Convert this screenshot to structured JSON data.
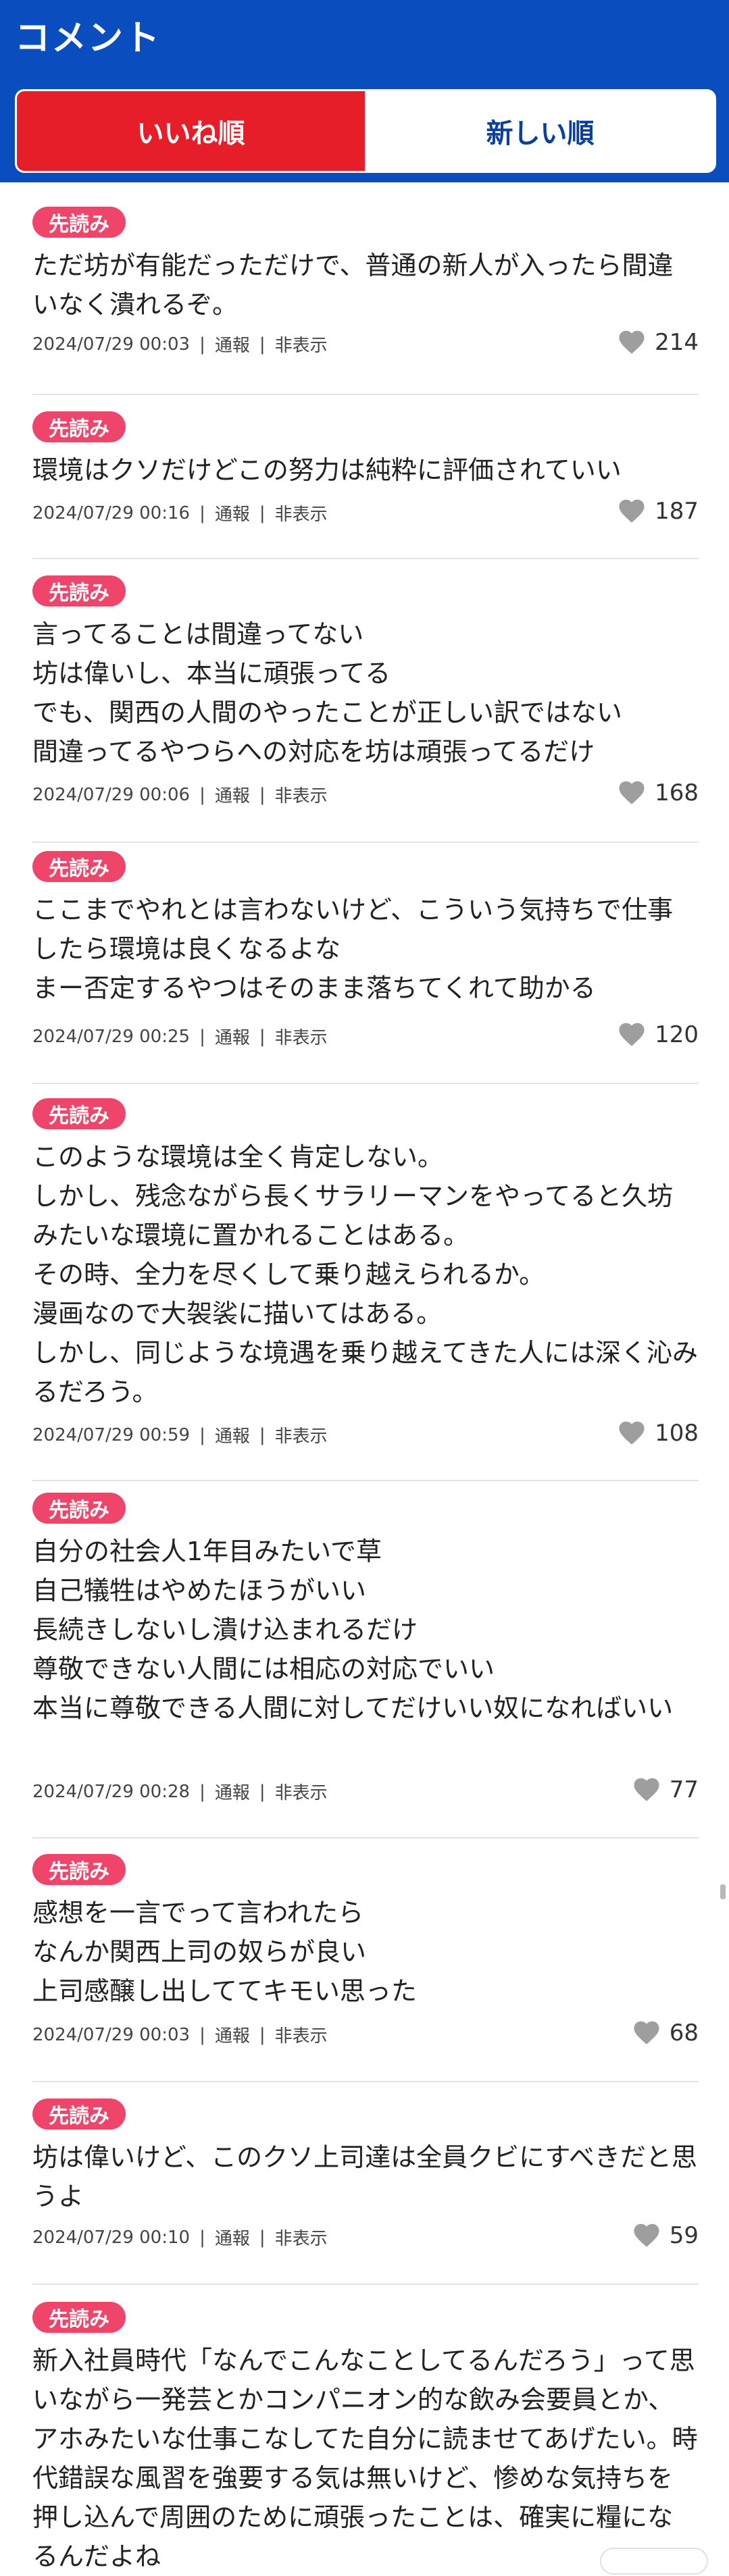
{
  "header": {
    "title": "コメント"
  },
  "tabs": [
    {
      "label": "いいね順",
      "active": true
    },
    {
      "label": "新しい順",
      "active": false
    }
  ],
  "colors": {
    "header_bg": "#0a4dbf",
    "active_tab": "#e61e2a",
    "badge": "#f0456a",
    "heart": "#9e9e9e"
  },
  "meta_labels": {
    "report": "通報",
    "hide": "非表示",
    "separator": "|"
  },
  "comments": [
    {
      "badge": "先読み",
      "text": "ただ坊が有能だっただけで、普通の新人が入ったら間違いなく潰れるぞ。",
      "date": "2024/07/29 00:03",
      "likes": "214"
    },
    {
      "badge": "先読み",
      "text": "環境はクソだけどこの努力は純粋に評価されていい",
      "date": "2024/07/29 00:16",
      "likes": "187"
    },
    {
      "badge": "先読み",
      "text": "言ってることは間違ってない\n坊は偉いし、本当に頑張ってる\nでも、関西の人間のやったことが正しい訳ではない\n間違ってるやつらへの対応を坊は頑張ってるだけ",
      "date": "2024/07/29 00:06",
      "likes": "168"
    },
    {
      "badge": "先読み",
      "text": "ここまでやれとは言わないけど、こういう気持ちで仕事したら環境は良くなるよな\nまー否定するやつはそのまま落ちてくれて助かる",
      "date": "2024/07/29 00:25",
      "likes": "120"
    },
    {
      "badge": "先読み",
      "text": "このような環境は全く肯定しない。\nしかし、残念ながら長くサラリーマンをやってると久坊みたいな環境に置かれることはある。\nその時、全力を尽くして乗り越えられるか。\n漫画なので大袈裟に描いてはある。\nしかし、同じような境遇を乗り越えてきた人には深く沁みるだろう。",
      "date": "2024/07/29 00:59",
      "likes": "108"
    },
    {
      "badge": "先読み",
      "text": "自分の社会人1年目みたいで草\n自己犠牲はやめたほうがいい\n長続きしないし潰け込まれるだけ\n尊敬できない人間には相応の対応でいい\n本当に尊敬できる人間に対してだけいい奴になればいい",
      "date": "2024/07/29 00:28",
      "likes": "77"
    },
    {
      "badge": "先読み",
      "text": "感想を一言でって言われたら\nなんか関西上司の奴らが良い\n上司感醸し出しててキモい思った",
      "date": "2024/07/29 00:03",
      "likes": "68"
    },
    {
      "badge": "先読み",
      "text": "坊は偉いけど、このクソ上司達は全員クビにすべきだと思うよ",
      "date": "2024/07/29 00:10",
      "likes": "59"
    },
    {
      "badge": "先読み",
      "text": "新入社員時代「なんでこんなことしてるんだろう」って思いながら一発芸とかコンパニオン的な飲み会要員とか、アホみたいな仕事こなしてた自分に読ませてあげたい。時代錯誤な風習を強要する気は無いけど、惨めな気持ちを押し込んで周囲のために頑張ったことは、確実に糧になるんだよね",
      "date": "",
      "likes": ""
    }
  ]
}
